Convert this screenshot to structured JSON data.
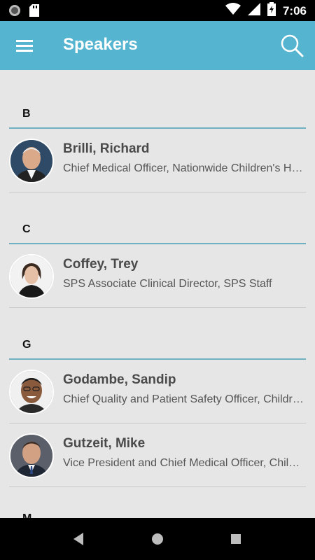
{
  "status_bar": {
    "time": "7:06"
  },
  "app_bar": {
    "title": "Speakers"
  },
  "sections": [
    {
      "letter": "B",
      "speakers": [
        {
          "name": "Brilli, Richard",
          "title": "Chief Medical Officer, Nationwide Children's Hospital"
        }
      ]
    },
    {
      "letter": "C",
      "speakers": [
        {
          "name": "Coffey, Trey",
          "title": "SPS Associate Clinical Director, SPS Staff"
        }
      ]
    },
    {
      "letter": "G",
      "speakers": [
        {
          "name": "Godambe, Sandip",
          "title": "Chief Quality and Patient Safety Officer, Children's"
        },
        {
          "name": "Gutzeit, Mike",
          "title": "Vice President and Chief Medical Officer, Children's"
        }
      ]
    }
  ],
  "peek_letter": "M",
  "colors": {
    "app_bar": "#55b4cf",
    "divider": "#6fb0c2",
    "background": "#e6e6e6"
  }
}
